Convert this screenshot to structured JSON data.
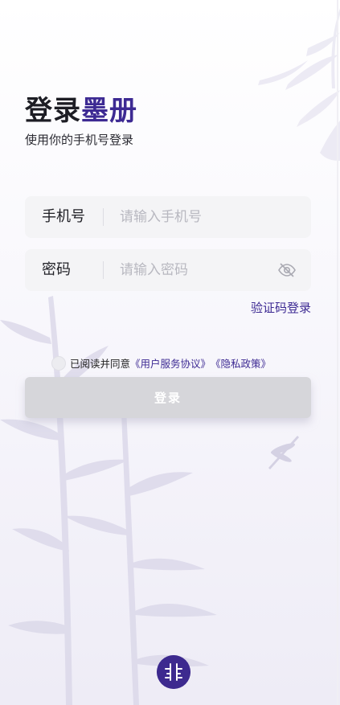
{
  "header": {
    "title_part1": "登录",
    "title_part2": "墨册",
    "subtitle": "使用你的手机号登录"
  },
  "phone_field": {
    "label": "手机号",
    "placeholder": "请输入手机号",
    "value": ""
  },
  "password_field": {
    "label": "密码",
    "placeholder": "请输入密码",
    "value": "",
    "toggle_icon": "eye-hidden-icon"
  },
  "alt_login": "验证码登录",
  "agreement": {
    "text": "已阅读并同意",
    "terms_link": "《用户服务协议》",
    "privacy_link": "《隐私政策》"
  },
  "login_button": "登录",
  "colors": {
    "brand": "#3d2a93",
    "button_disabled": "#d6d6da"
  }
}
